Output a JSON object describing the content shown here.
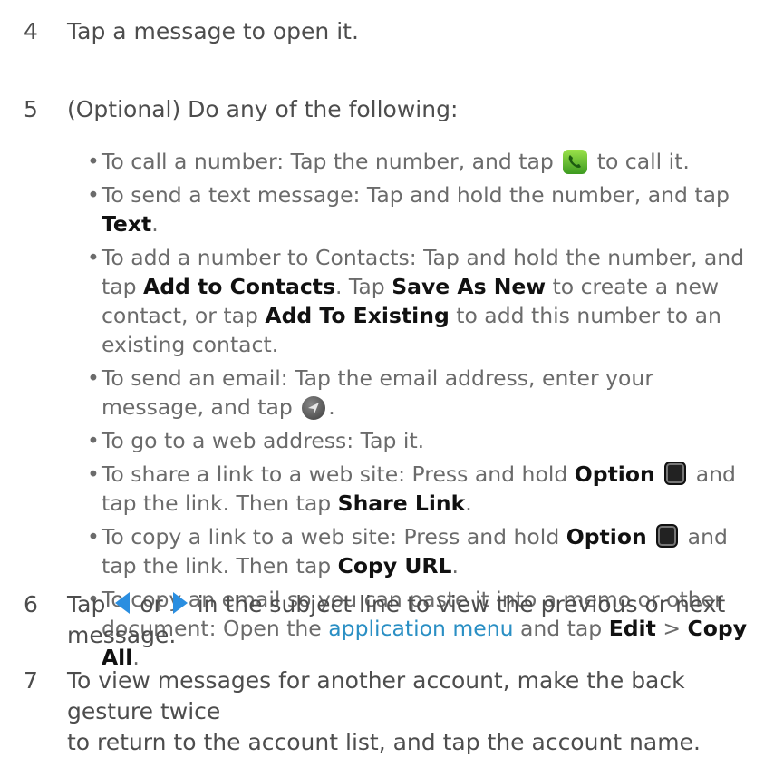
{
  "steps": [
    {
      "num": "4",
      "text": "Tap a message to open it."
    },
    {
      "num": "5",
      "text": "(Optional) Do any of the following:"
    },
    {
      "num": "6",
      "pre": "Tap",
      "mid": "or",
      "post": "in the subject line to view the previous or next message."
    },
    {
      "num": "7",
      "line1": "To view messages for another account, make the back gesture twice",
      "line2": "to return to the account list, and tap the account name."
    }
  ],
  "bullets": {
    "call": {
      "pre": "To call a number: Tap the number, and tap",
      "post": "to call it."
    },
    "text": {
      "pre": "To send a text message: Tap and hold the number, and tap",
      "bold": "Text",
      "post": "."
    },
    "contacts": {
      "pre": "To add a number to Contacts: Tap and hold the number, and tap",
      "bold1": "Add to Contacts",
      "mid1": ". Tap",
      "bold2": "Save As New",
      "mid2": "to create a new contact, or tap",
      "bold3": "Add To Existing",
      "post": "to add this number to an existing contact."
    },
    "email": {
      "pre": "To send an email: Tap the email address, enter your message, and tap",
      "post": "."
    },
    "web": {
      "text": "To go to a web address: Tap it."
    },
    "share": {
      "pre": "To share a link to a web site: Press and hold",
      "bold1": "Option",
      "mid": "and tap the link. Then tap",
      "bold2": "Share Link",
      "post": "."
    },
    "copy": {
      "pre": "To copy a link to a web site: Press and hold",
      "bold1": "Option",
      "mid": "and tap the link. Then tap",
      "bold2": "Copy URL",
      "post": "."
    },
    "memo": {
      "pre": "To copy an email so you can paste it into a memo or other document: Open the",
      "link": "application menu",
      "mid": "and tap",
      "bold1": "Edit",
      "sep": ">",
      "bold2": "Copy All",
      "post": "."
    }
  },
  "icons": {
    "phone": "phone-icon",
    "send": "send-icon",
    "option": "option-key-icon",
    "prev": "previous-arrow-icon",
    "next": "next-arrow-icon"
  },
  "colors": {
    "link": "#2a8fc4",
    "accent_green": "#5bbf2e",
    "arrow_blue": "#2a8ee0"
  }
}
